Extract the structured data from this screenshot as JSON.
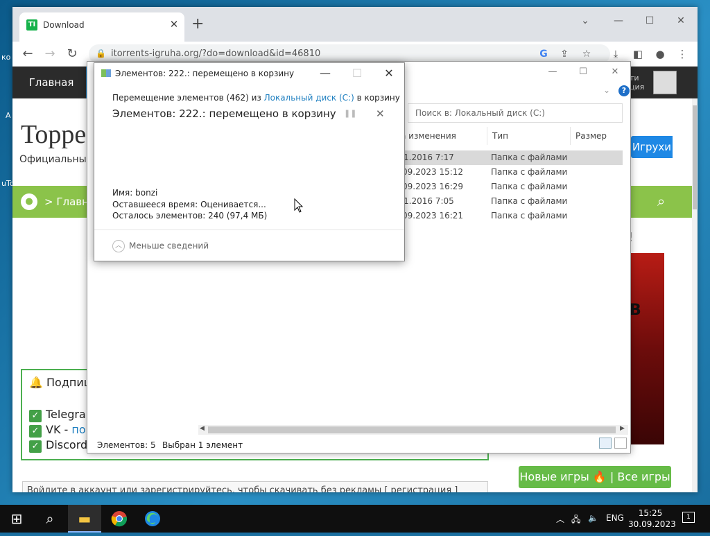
{
  "desktop": {
    "fragments": [
      "ко",
      "А",
      "uTo"
    ]
  },
  "browser": {
    "tab_title": "Download",
    "tab_favicon": "TI",
    "url": "itorrents-igruha.org/?do=download&id=46810",
    "icons": {
      "back": "back-icon",
      "forward": "forward-icon",
      "reload": "reload-icon"
    }
  },
  "site": {
    "nav_home": "Главная",
    "account_line1": "ти",
    "account_line2": "ция",
    "logo": "Торре",
    "slogan": "Официальный с",
    "breadcrumb": "> Главна",
    "igruhi_btn": "Игрухи",
    "exclaim": "!",
    "poster_text": "В",
    "subscribe_title": "Подпиш",
    "subscribe_items": [
      {
        "prefix": "Telegra",
        "link": ""
      },
      {
        "prefix": "VK - ",
        "link": "по"
      },
      {
        "prefix": "Discord",
        "link": ""
      }
    ],
    "notice": "Войдите в аккаунт или зарегистрируйтесь, чтобы скачивать без рекламы [ регистрация ]",
    "new_games_btn": "Новые игры 🔥 | Все игры"
  },
  "explorer": {
    "search_placeholder": "Поиск в: Локальный диск (C:)",
    "columns": [
      "а изменения",
      "Тип",
      "Размер"
    ],
    "rows": [
      {
        "date": "1.2016 7:17",
        "type": "Папка с файлами"
      },
      {
        "date": "09.2023 15:12",
        "type": "Папка с файлами"
      },
      {
        "date": "09.2023 16:29",
        "type": "Папка с файлами"
      },
      {
        "date": "1.2016 7:05",
        "type": "Папка с файлами"
      },
      {
        "date": "09.2023 16:21",
        "type": "Папка с файлами"
      }
    ],
    "status_items": "Элементов: 5",
    "status_selected": "Выбран 1 элемент"
  },
  "dialog": {
    "title": "Элементов: 222.: перемещено в корзину",
    "line1_prefix": "Перемещение элементов (462) из ",
    "line1_link": "Локальный диск (C:)",
    "line1_suffix": " в корзину",
    "headline": "Элементов: 222.: перемещено в корзину",
    "name_label": "Имя:",
    "name_value": "bonzi",
    "time_label": "Оставшееся время:",
    "time_value": "Оценивается...",
    "remaining_label": "Осталось элементов:",
    "remaining_value": "240 (97,4 МБ)",
    "less_details": "Меньше сведений"
  },
  "taskbar": {
    "lang": "ENG",
    "time": "15:25",
    "date": "30.09.2023",
    "notifications": "1"
  }
}
